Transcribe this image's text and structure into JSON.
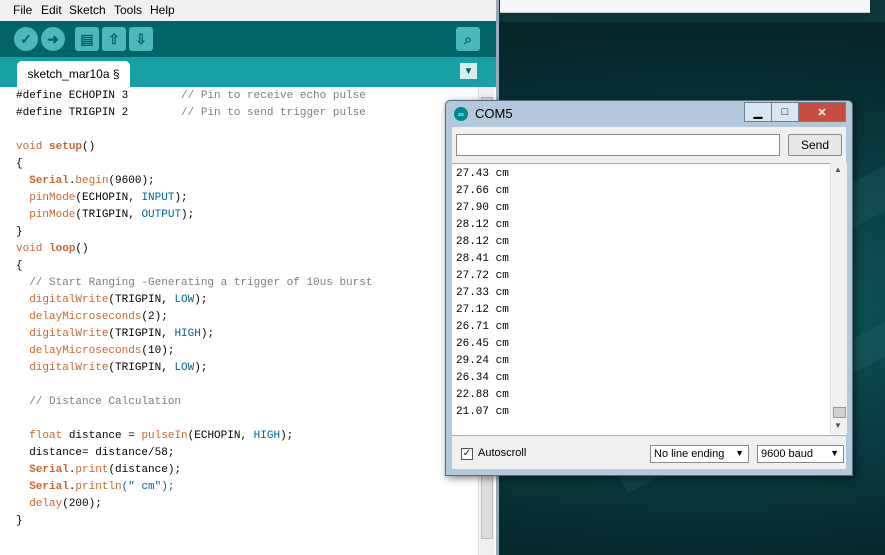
{
  "ide": {
    "menu": [
      "File",
      "Edit",
      "Sketch",
      "Tools",
      "Help"
    ],
    "tab_name": "sketch_mar10a §",
    "code_lines": [
      [
        {
          "t": "#define ECHOPIN 3        "
        },
        {
          "t": "// Pin to receive echo pulse",
          "c": "cmt"
        }
      ],
      [
        {
          "t": "#define TRIGPIN 2        "
        },
        {
          "t": "// Pin to send trigger pulse",
          "c": "cmt"
        }
      ],
      [
        {
          "t": ""
        }
      ],
      [
        {
          "t": "void ",
          "c": "kw"
        },
        {
          "t": "setup",
          "c": "kwb"
        },
        {
          "t": "()"
        }
      ],
      [
        {
          "t": "{"
        }
      ],
      [
        {
          "t": "  "
        },
        {
          "t": "Serial",
          "c": "kwb"
        },
        {
          "t": "."
        },
        {
          "t": "begin",
          "c": "fn"
        },
        {
          "t": "(9600);"
        }
      ],
      [
        {
          "t": "  "
        },
        {
          "t": "pinMode",
          "c": "fn"
        },
        {
          "t": "(ECHOPIN, "
        },
        {
          "t": "INPUT",
          "c": "cst"
        },
        {
          "t": ");"
        }
      ],
      [
        {
          "t": "  "
        },
        {
          "t": "pinMode",
          "c": "fn"
        },
        {
          "t": "(TRIGPIN, "
        },
        {
          "t": "OUTPUT",
          "c": "cst"
        },
        {
          "t": ");"
        }
      ],
      [
        {
          "t": "}"
        }
      ],
      [
        {
          "t": "void ",
          "c": "kw"
        },
        {
          "t": "loop",
          "c": "kwb"
        },
        {
          "t": "()"
        }
      ],
      [
        {
          "t": "{"
        }
      ],
      [
        {
          "t": "  "
        },
        {
          "t": "// Start Ranging -Generating a trigger of 10us burst",
          "c": "cmt"
        }
      ],
      [
        {
          "t": "  "
        },
        {
          "t": "digitalWrite",
          "c": "fn"
        },
        {
          "t": "(TRIGPIN, "
        },
        {
          "t": "LOW",
          "c": "cst"
        },
        {
          "t": ");"
        }
      ],
      [
        {
          "t": "  "
        },
        {
          "t": "delayMicroseconds",
          "c": "fn"
        },
        {
          "t": "(2);"
        }
      ],
      [
        {
          "t": "  "
        },
        {
          "t": "digitalWrite",
          "c": "fn"
        },
        {
          "t": "(TRIGPIN, "
        },
        {
          "t": "HIGH",
          "c": "cst"
        },
        {
          "t": ");"
        }
      ],
      [
        {
          "t": "  "
        },
        {
          "t": "delayMicroseconds",
          "c": "fn"
        },
        {
          "t": "(10);"
        }
      ],
      [
        {
          "t": "  "
        },
        {
          "t": "digitalWrite",
          "c": "fn"
        },
        {
          "t": "(TRIGPIN, "
        },
        {
          "t": "LOW",
          "c": "cst"
        },
        {
          "t": ");"
        }
      ],
      [
        {
          "t": ""
        }
      ],
      [
        {
          "t": "  "
        },
        {
          "t": "// Distance Calculation",
          "c": "cmt"
        }
      ],
      [
        {
          "t": ""
        }
      ],
      [
        {
          "t": "  "
        },
        {
          "t": "float ",
          "c": "kw"
        },
        {
          "t": "distance = "
        },
        {
          "t": "pulseIn",
          "c": "fn"
        },
        {
          "t": "(ECHOPIN, "
        },
        {
          "t": "HIGH",
          "c": "cst"
        },
        {
          "t": ");"
        }
      ],
      [
        {
          "t": "  distance= distance/58;"
        }
      ],
      [
        {
          "t": "  "
        },
        {
          "t": "Serial",
          "c": "kwb"
        },
        {
          "t": "."
        },
        {
          "t": "print",
          "c": "fn"
        },
        {
          "t": "(distance);"
        }
      ],
      [
        {
          "t": "  "
        },
        {
          "t": "Serial",
          "c": "kwb"
        },
        {
          "t": "."
        },
        {
          "t": "println",
          "c": "fn"
        },
        {
          "t": "(\" cm\");",
          "c": "str"
        }
      ],
      [
        {
          "t": "  "
        },
        {
          "t": "delay",
          "c": "fn"
        },
        {
          "t": "(200);"
        }
      ],
      [
        {
          "t": "}"
        }
      ]
    ]
  },
  "serial": {
    "title": "COM5",
    "send_label": "Send",
    "input_value": "",
    "output_lines": [
      "27.43 cm",
      "27.66 cm",
      "27.90 cm",
      "28.12 cm",
      "28.12 cm",
      "28.41 cm",
      "27.72 cm",
      "27.33 cm",
      "27.12 cm",
      "26.71 cm",
      "26.45 cm",
      "29.24 cm",
      "26.34 cm",
      "22.88 cm",
      "21.07 cm"
    ],
    "autoscroll_label": "Autoscroll",
    "autoscroll_checked": true,
    "line_ending": "No line ending",
    "baud": "9600 baud"
  }
}
